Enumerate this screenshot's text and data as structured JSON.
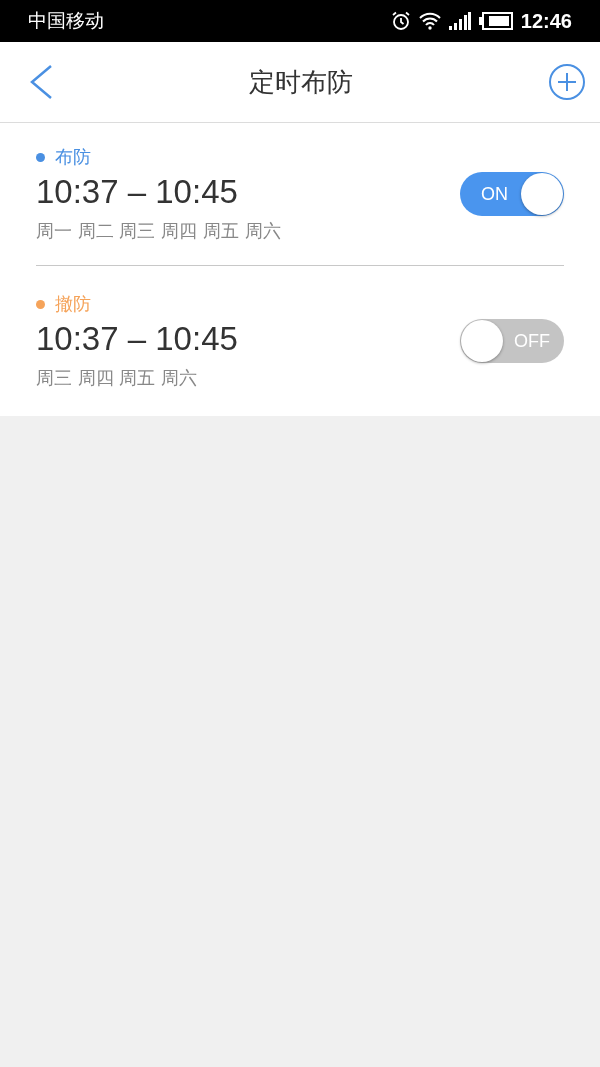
{
  "status_bar": {
    "carrier": "中国移动",
    "time": "12:46"
  },
  "header": {
    "title": "定时布防"
  },
  "schedules": [
    {
      "mode": "布防",
      "color": "#4a90e2",
      "time": "10:37 – 10:45",
      "days": "周一 周二 周三 周四 周五 周六",
      "on": true,
      "switch_label": "ON"
    },
    {
      "mode": "撤防",
      "color": "#f5a35a",
      "time": "10:37 – 10:45",
      "days": "周三 周四 周五 周六",
      "on": false,
      "switch_label": "OFF"
    }
  ]
}
